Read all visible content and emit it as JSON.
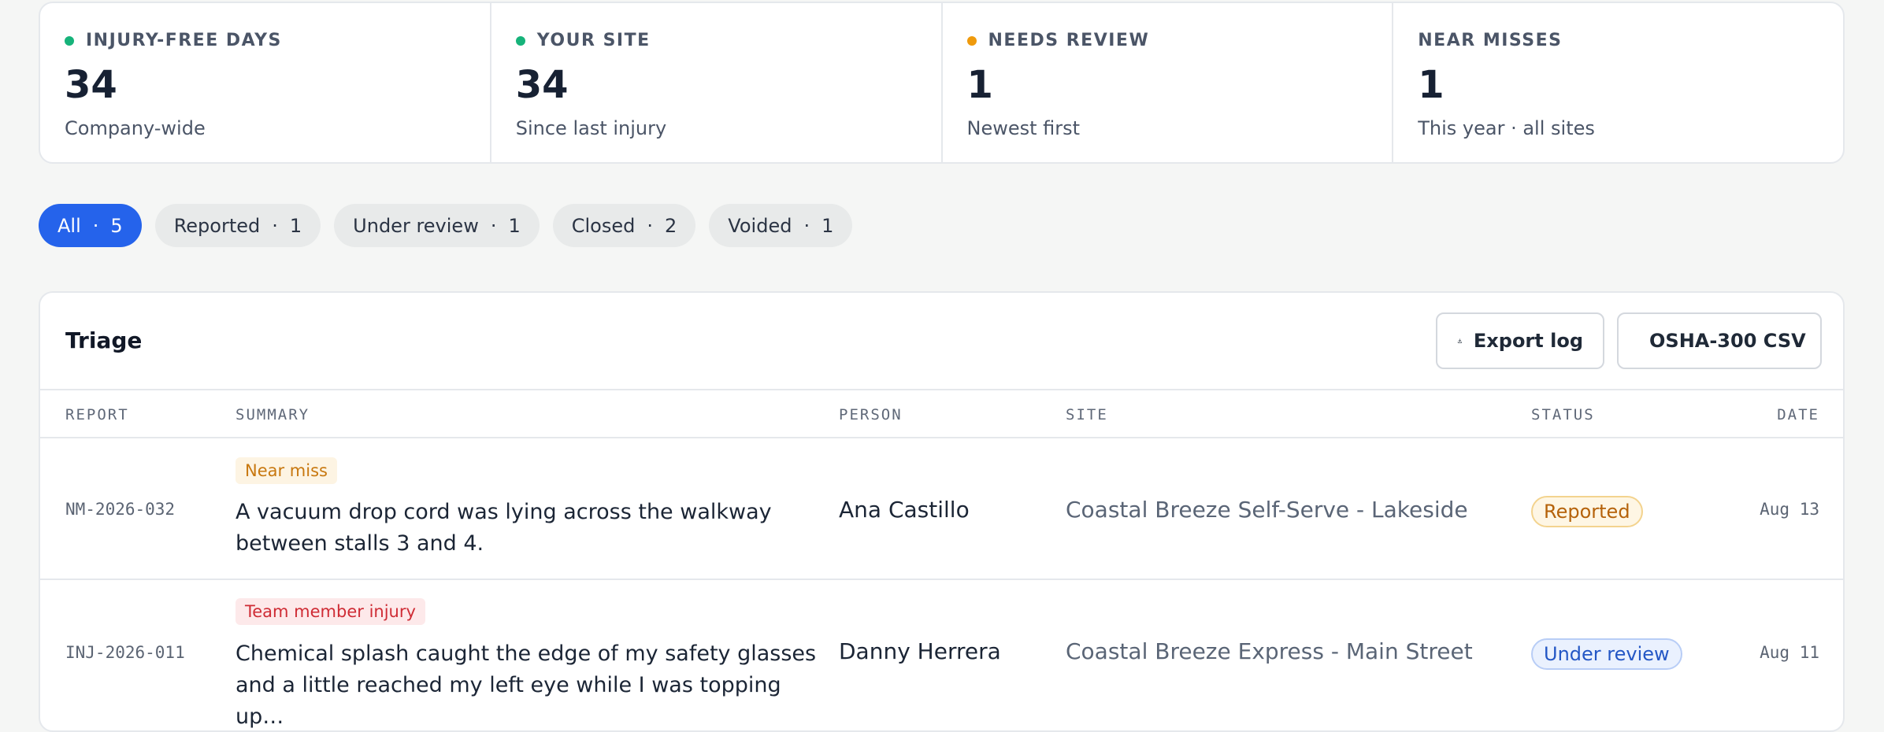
{
  "stats": [
    {
      "label": "INJURY-FREE DAYS",
      "value": "34",
      "sub": "Company-wide",
      "dot_color": "#16b37a"
    },
    {
      "label": "YOUR SITE",
      "value": "34",
      "sub": "Since last injury",
      "dot_color": "#16b37a"
    },
    {
      "label": "NEEDS REVIEW",
      "value": "1",
      "sub": "Newest first",
      "dot_color": "#ef9a0c"
    },
    {
      "label": "NEAR MISSES",
      "value": "1",
      "sub": "This year · all sites",
      "dot_color": ""
    }
  ],
  "filters": [
    {
      "label": "All",
      "count": "5",
      "active": true
    },
    {
      "label": "Reported",
      "count": "1",
      "active": false
    },
    {
      "label": "Under review",
      "count": "1",
      "active": false
    },
    {
      "label": "Closed",
      "count": "2",
      "active": false
    },
    {
      "label": "Voided",
      "count": "1",
      "active": false
    }
  ],
  "filter_separator": "·",
  "triage": {
    "title": "Triage",
    "export_label": "Export log",
    "osha_label": "OSHA-300 CSV",
    "columns": {
      "report": "REPORT",
      "summary": "SUMMARY",
      "person": "PERSON",
      "site": "SITE",
      "status": "STATUS",
      "date": "DATE"
    },
    "rows": [
      {
        "report": "NM-2026-032",
        "tag": "Near miss",
        "summary": "A vacuum drop cord was lying across the walkway between stalls 3 and 4.",
        "person": "Ana Castillo",
        "site": "Coastal Breeze Self-Serve - Lakeside",
        "status": "Reported",
        "date": "Aug 13"
      },
      {
        "report": "INJ-2026-011",
        "tag": "Team member injury",
        "summary": "Chemical splash caught the edge of my safety glasses and a little reached my left eye while I was topping up…",
        "person": "Danny Herrera",
        "site": "Coastal Breeze Express - Main Street",
        "status": "Under review",
        "date": "Aug 11"
      }
    ]
  },
  "colors": {
    "accent": "#2563eb",
    "good": "#16b37a",
    "warn": "#ef9a0c"
  }
}
